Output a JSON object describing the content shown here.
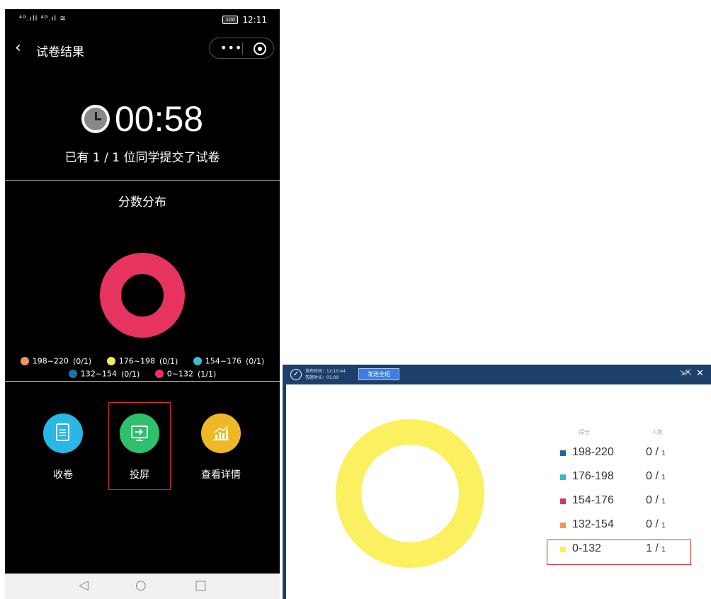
{
  "phone": {
    "status": {
      "signal": "⁴ᴳ.ıll ⁴ᴳ.ıl ≋",
      "battery": "100",
      "time": "12:11"
    },
    "nav": {
      "title": "试卷结果",
      "more": "•••"
    },
    "timer": "00:58",
    "submitted_text": "已有 1 / 1 位同学提交了试卷",
    "distribution_title": "分数分布",
    "legend": [
      {
        "label": "198~220",
        "count": "(0/1)",
        "color": "#f0965a"
      },
      {
        "label": "176~198",
        "count": "(0/1)",
        "color": "#f7e95c"
      },
      {
        "label": "154~176",
        "count": "(0/1)",
        "color": "#3dbbd0"
      },
      {
        "label": "132~154",
        "count": "(0/1)",
        "color": "#1f6fa8"
      },
      {
        "label": "0~132",
        "count": "(1/1)",
        "color": "#e6335f"
      }
    ],
    "donut_color": "#e6335f",
    "actions": [
      {
        "label": "收卷",
        "icon": "document-icon",
        "color": "#27b8e6"
      },
      {
        "label": "投屏",
        "icon": "screen-cast-icon",
        "color": "#2fc06b"
      },
      {
        "label": "查看详情",
        "icon": "bar-chart-icon",
        "color": "#efb827"
      }
    ],
    "android_nav": {
      "back": "◁",
      "home": "○",
      "recent": "□"
    }
  },
  "desktop": {
    "header": {
      "publish_time": "发布时间：12:10:44",
      "duration": "答题时长：01:09",
      "send_all": "发送全班",
      "shrink": "⇲⇱",
      "close": "✕"
    },
    "table": {
      "score_header": "得分",
      "people_header": "人数",
      "rows": [
        {
          "range": "198-220",
          "count": "0",
          "total": "1",
          "color": "#1a6aa3"
        },
        {
          "range": "176-198",
          "count": "0",
          "total": "1",
          "color": "#3cb4cc"
        },
        {
          "range": "154-176",
          "count": "0",
          "total": "1",
          "color": "#d9365e"
        },
        {
          "range": "132-154",
          "count": "0",
          "total": "1",
          "color": "#f0965a"
        },
        {
          "range": "0-132",
          "count": "1",
          "total": "1",
          "color": "#f7ee5c"
        }
      ]
    },
    "donut_color": "#fbf05f"
  }
}
